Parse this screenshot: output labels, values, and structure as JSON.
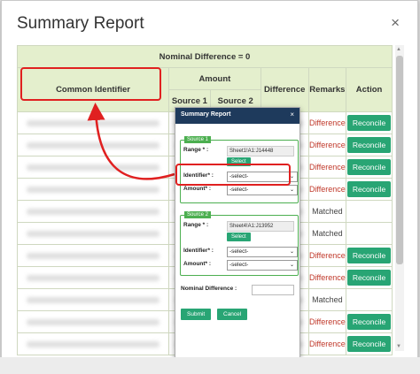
{
  "dialog": {
    "title": "Summary Report",
    "close_label": "×"
  },
  "table": {
    "nominal_header": "Nominal Difference = 0",
    "common_identifier_header": "Common Identifier",
    "amount_header": "Amount",
    "source1_header": "Source 1",
    "source2_header": "Source 2",
    "difference_header": "Difference",
    "remarks_header": "Remarks",
    "action_header": "Action",
    "rows": [
      {
        "remarks": "Difference",
        "action": "Reconcile"
      },
      {
        "remarks": "Difference",
        "action": "Reconcile"
      },
      {
        "remarks": "Difference",
        "action": "Reconcile"
      },
      {
        "remarks": "Difference",
        "action": "Reconcile"
      },
      {
        "remarks": "Matched",
        "action": ""
      },
      {
        "remarks": "Matched",
        "action": ""
      },
      {
        "remarks": "Difference",
        "action": "Reconcile"
      },
      {
        "remarks": "Difference",
        "action": "Reconcile"
      },
      {
        "remarks": "Matched",
        "action": ""
      },
      {
        "remarks": "Difference",
        "action": "Reconcile"
      },
      {
        "remarks": "Difference",
        "action": "Reconcile"
      }
    ]
  },
  "popup": {
    "title": "Summary Report",
    "close_label": "×",
    "source1": {
      "tag": "Source 1",
      "range_label": "Range * :",
      "range_value": "Sheet1!A1:J14448",
      "select_button": "Select",
      "identifier_label": "Identifier* :",
      "identifier_value": "-select-",
      "amount_label": "Amount* :",
      "amount_value": "-select-"
    },
    "source2": {
      "tag": "Source 2",
      "range_label": "Range * :",
      "range_value": "Sheet4!A1:J13952",
      "select_button": "Select",
      "identifier_label": "Identifier* :",
      "identifier_value": "-select-",
      "amount_label": "Amount* :",
      "amount_value": "-select-"
    },
    "nominal_difference_label": "Nominal Difference :",
    "submit_label": "Submit",
    "cancel_label": "Cancel"
  },
  "colors": {
    "header_bg": "#e4efcd",
    "button_green": "#28a574",
    "difference_red": "#c0392b",
    "highlight_red": "#e02020",
    "popup_header": "#1e3a5c"
  }
}
